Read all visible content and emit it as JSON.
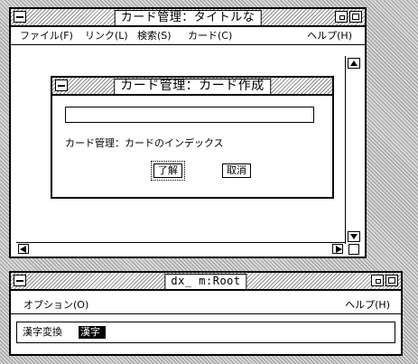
{
  "card_window": {
    "title": "カード管理：タイトルな",
    "menu": [
      "ファイル(F)",
      "リンク(L)",
      "検索(S)",
      "カード(C)"
    ],
    "help": "ヘルプ(H)"
  },
  "dialog": {
    "title": "カード管理：カード作成",
    "input_value": "",
    "label": "カード管理：カードのインデックス",
    "ok": "了解",
    "cancel": "取消"
  },
  "root_window": {
    "title": "dx_ m:Root",
    "options": "オプション(O)",
    "help": "ヘルプ(H)",
    "kanji_label": "漢字変換",
    "kanji_value": "漢字"
  }
}
